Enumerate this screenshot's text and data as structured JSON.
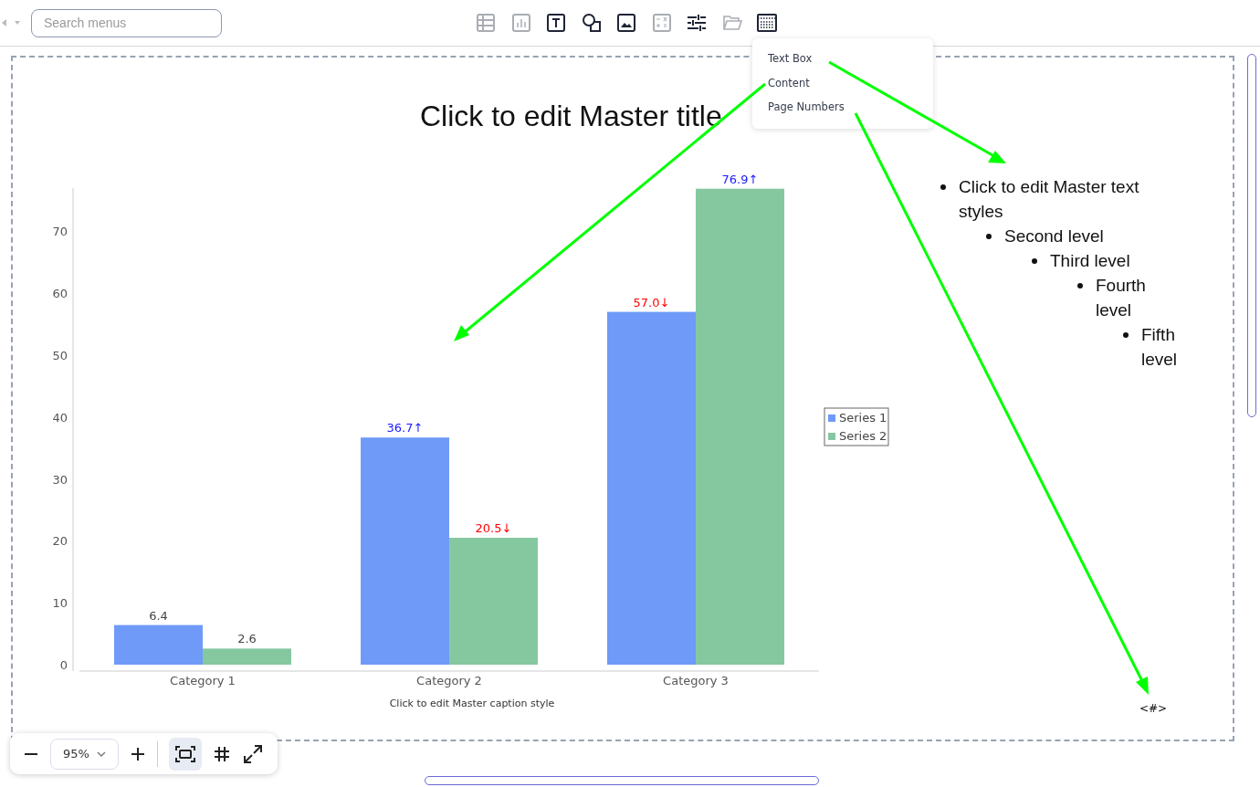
{
  "toolbar": {
    "search": {
      "placeholder": "Search menus"
    },
    "tools": [
      {
        "kind": "table",
        "disabled": true
      },
      {
        "kind": "chart",
        "disabled": true
      },
      {
        "kind": "text-box",
        "disabled": false
      },
      {
        "kind": "shapes",
        "disabled": false
      },
      {
        "kind": "image",
        "disabled": false
      },
      {
        "kind": "formula",
        "disabled": true
      },
      {
        "kind": "sliders",
        "disabled": false
      },
      {
        "kind": "folder",
        "disabled": true
      },
      {
        "kind": "header-footer",
        "disabled": false
      }
    ]
  },
  "insert_menu": {
    "items": [
      "Text Box",
      "Content",
      "Page Numbers"
    ]
  },
  "slide": {
    "title": "Click to edit Master title",
    "chart_data": {
      "type": "bar",
      "categories": [
        "Category 1",
        "Category 2",
        "Category 3"
      ],
      "ylim": [
        0,
        77
      ],
      "yticks": [
        0,
        10,
        20,
        30,
        40,
        50,
        60,
        70
      ],
      "legend": true,
      "series": [
        {
          "name": "Series 1",
          "color": "#6f9af8",
          "values": [
            6.4,
            36.7,
            57.0
          ],
          "value_labels": [
            "6.4",
            "36.7↑",
            "57.0↓"
          ]
        },
        {
          "name": "Series 2",
          "color": "#85c8a0",
          "values": [
            2.6,
            20.5,
            76.9
          ],
          "value_labels": [
            "2.6",
            "20.5↓",
            "76.9↑"
          ]
        }
      ]
    },
    "value_label_groups": [
      {
        "labels": [
          {
            "color": "#444444"
          },
          {
            "color": "#1a1aff"
          },
          {
            "color": "#ff0000"
          }
        ]
      },
      {
        "labels": [
          {
            "color": "#444444"
          },
          {
            "color": "#ff0000"
          },
          {
            "color": "#1a1aff"
          }
        ]
      }
    ],
    "caption": "Click to edit Master caption style",
    "body": [
      {
        "text": "Click to edit Master text styles",
        "children": [
          {
            "text": "Second level",
            "children": [
              {
                "text": "Third level",
                "children": [
                  {
                    "text": "Fourth level",
                    "children": [
                      {
                        "text": "Fifth level"
                      }
                    ]
                  }
                ]
              }
            ]
          }
        ]
      }
    ],
    "page_number": "<#>"
  },
  "zoom": {
    "value": "95%",
    "fit_selected": true
  }
}
